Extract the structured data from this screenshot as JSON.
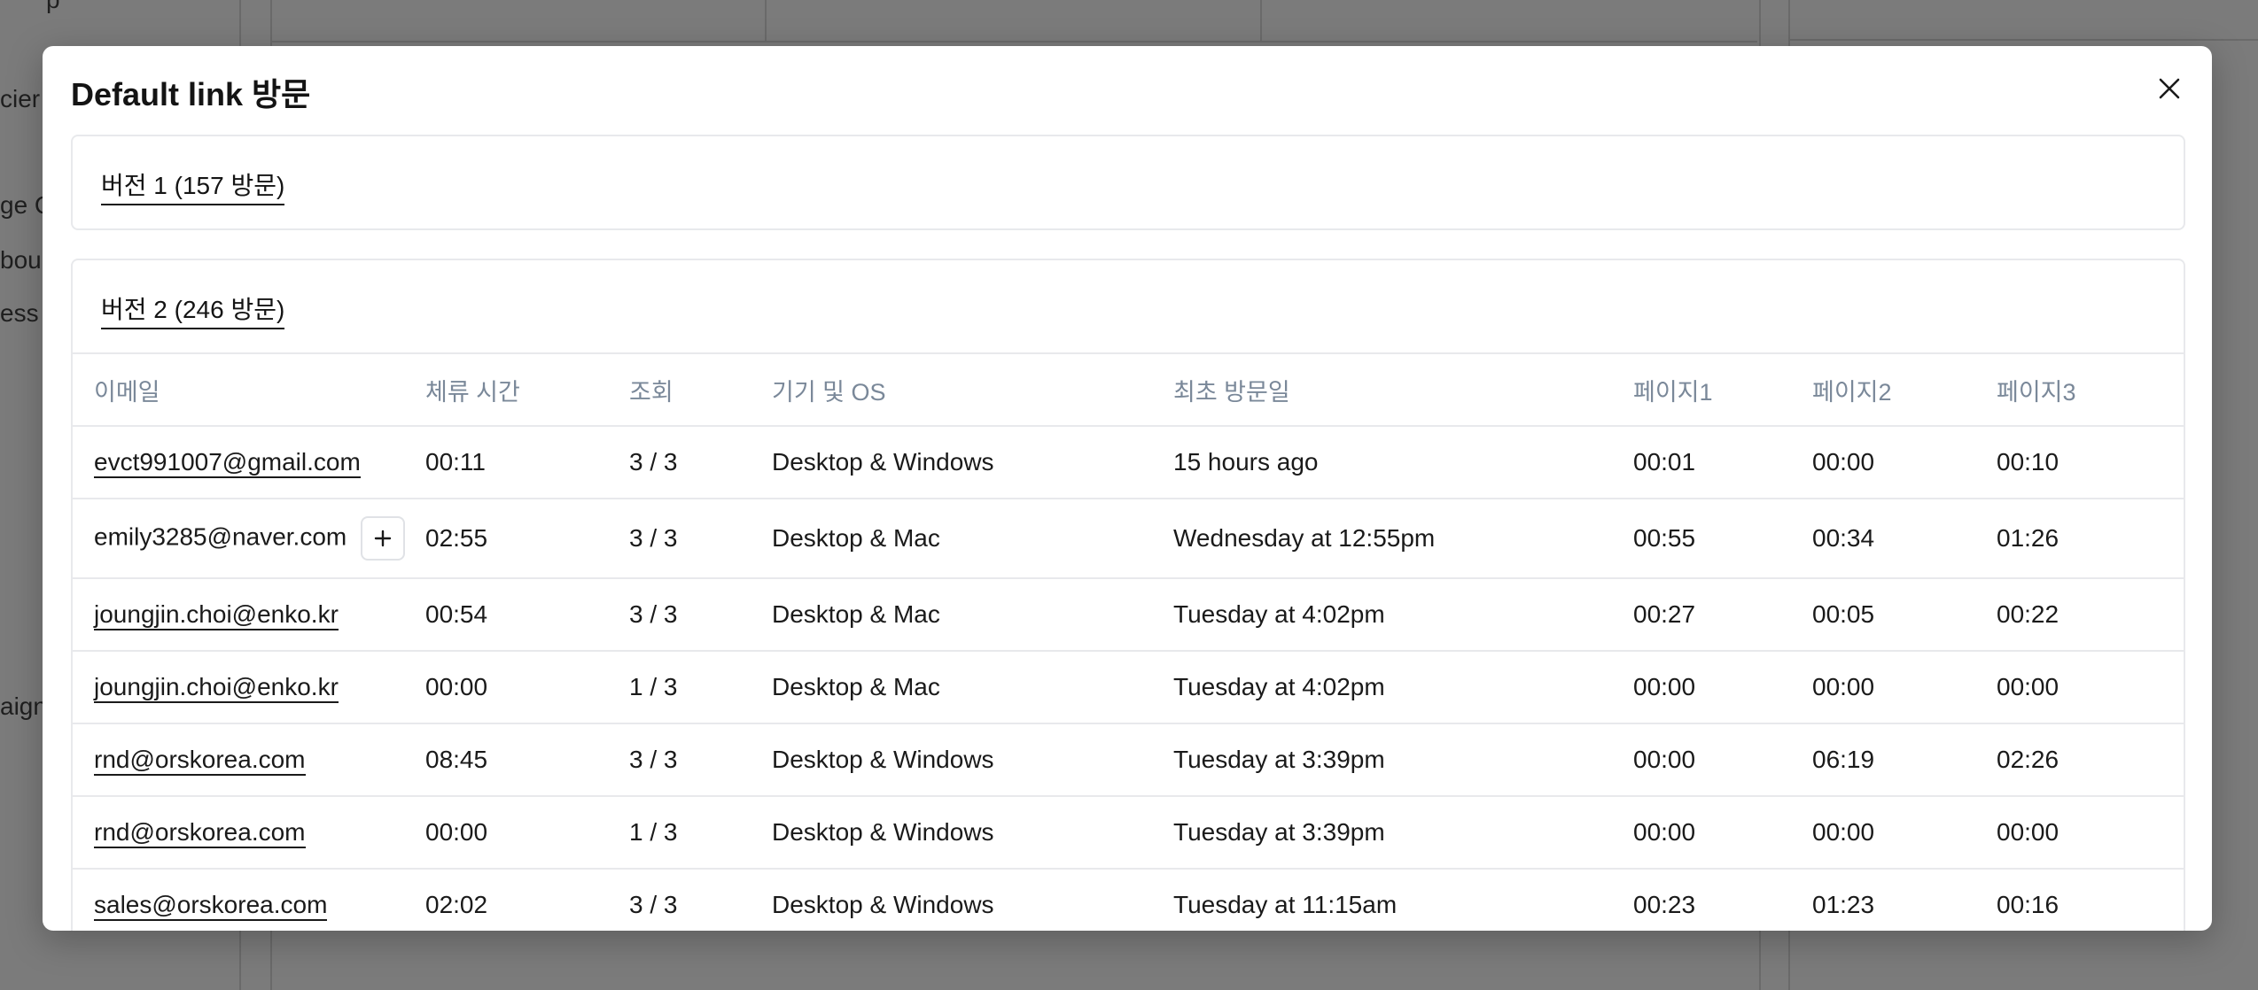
{
  "background": {
    "sidebar_fragments": [
      "p",
      "cier",
      "ge C",
      "bou",
      "ess",
      "aign"
    ]
  },
  "modal": {
    "title": "Default link 방문",
    "close_icon": "close-icon",
    "version1": {
      "label": "버전 1 (157 방문)"
    },
    "version2": {
      "label": "버전 2 (246 방문)",
      "columns": [
        "이메일",
        "체류 시간",
        "조회",
        "기기 및 OS",
        "최초 방문일",
        "페이지1",
        "페이지2",
        "페이지3"
      ],
      "rows": [
        {
          "email": "evct991007@gmail.com",
          "duration": "00:11",
          "views": "3 / 3",
          "device": "Desktop & Windows",
          "first_visit": "15 hours ago",
          "p1": "00:01",
          "p2": "00:00",
          "p3": "00:10"
        },
        {
          "email": "emily3285@naver.com",
          "duration": "02:55",
          "views": "3 / 3",
          "device": "Desktop & Mac",
          "first_visit": "Wednesday at 12:55pm",
          "p1": "00:55",
          "p2": "00:34",
          "p3": "01:26"
        },
        {
          "email": "joungjin.choi@enko.kr",
          "duration": "00:54",
          "views": "3 / 3",
          "device": "Desktop & Mac",
          "first_visit": "Tuesday at 4:02pm",
          "p1": "00:27",
          "p2": "00:05",
          "p3": "00:22"
        },
        {
          "email": "joungjin.choi@enko.kr",
          "duration": "00:00",
          "views": "1 / 3",
          "device": "Desktop & Mac",
          "first_visit": "Tuesday at 4:02pm",
          "p1": "00:00",
          "p2": "00:00",
          "p3": "00:00"
        },
        {
          "email": "rnd@orskorea.com",
          "duration": "08:45",
          "views": "3 / 3",
          "device": "Desktop & Windows",
          "first_visit": "Tuesday at 3:39pm",
          "p1": "00:00",
          "p2": "06:19",
          "p3": "02:26"
        },
        {
          "email": "rnd@orskorea.com",
          "duration": "00:00",
          "views": "1 / 3",
          "device": "Desktop & Windows",
          "first_visit": "Tuesday at 3:39pm",
          "p1": "00:00",
          "p2": "00:00",
          "p3": "00:00"
        },
        {
          "email": "sales@orskorea.com",
          "duration": "02:02",
          "views": "3 / 3",
          "device": "Desktop & Windows",
          "first_visit": "Tuesday at 11:15am",
          "p1": "00:23",
          "p2": "01:23",
          "p3": "00:16"
        }
      ]
    }
  }
}
